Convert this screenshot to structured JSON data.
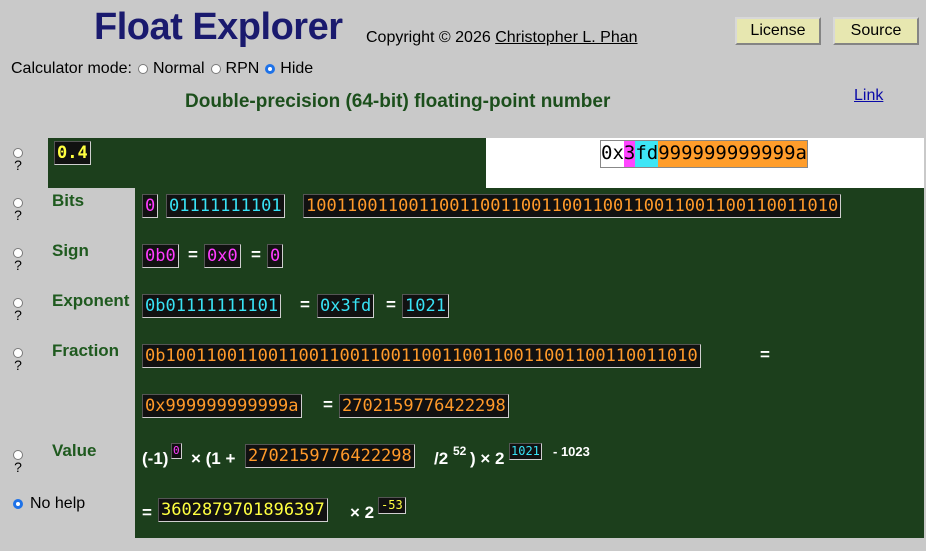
{
  "header": {
    "title": "Float Explorer",
    "copyright_prefix": "Copyright © 2026 ",
    "author": "Christopher L. Phan",
    "license_label": "License",
    "source_label": "Source"
  },
  "mode": {
    "label": "Calculator mode:",
    "options": [
      "Normal",
      "RPN",
      "Hide"
    ],
    "selected": "Hide"
  },
  "subtitle": "Double-precision (64-bit) floating-point number",
  "link_label": "Link",
  "input": {
    "value": "0.4"
  },
  "hex_display": {
    "prefix": "0x",
    "sign_part": "3",
    "exp_part": "fd",
    "frac_part": "999999999999a"
  },
  "rows": {
    "bits": {
      "label": "Bits",
      "sign": "0",
      "exponent": "01111111101",
      "fraction": "1001100110011001100110011001100110011001100110011010"
    },
    "sign": {
      "label": "Sign",
      "bin": "0b0",
      "hex": "0x0",
      "dec": "0"
    },
    "exponent": {
      "label": "Exponent",
      "bin": "0b01111111101",
      "hex": "0x3fd",
      "dec": "1021"
    },
    "fraction": {
      "label": "Fraction",
      "bin": "0b1001100110011001100110011001100110011001100110011010",
      "hex": "0x999999999999a",
      "dec": "2702159776422298"
    },
    "value": {
      "label": "Value",
      "neg_one": "(-1)",
      "sign_exp": "0",
      "times_one_plus": "× (1 +",
      "frac": "2702159776422298",
      "over_two": "/2",
      "pow52": "52",
      "close_times_two": ") × 2",
      "exp": "1021",
      "minus_bias": "- 1023",
      "significand": "3602879701896397",
      "times_two": "× 2",
      "final_exp": "-53"
    }
  },
  "help": {
    "no_help_label": "No help",
    "question": "?"
  },
  "equals": "="
}
